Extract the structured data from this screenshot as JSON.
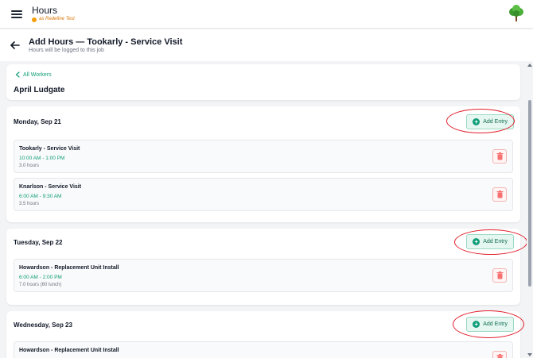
{
  "app": {
    "title": "Hours",
    "user_label": "as Redefine Test",
    "accent_color": "#0f9d78",
    "logo_icon": "tree-icon"
  },
  "header": {
    "title": "Add Hours — Tookarly - Service Visit",
    "subtitle": "Hours will be logged to this job"
  },
  "worker": {
    "back_label": "All Workers",
    "name": "April Ludgate"
  },
  "add_entry_label": "Add Entry",
  "days": [
    {
      "label": "Monday, Sep 21",
      "entries": [
        {
          "title": "Tookarly - Service Visit",
          "time": "10:00 AM - 1:00 PM",
          "duration": "3.0 hours"
        },
        {
          "title": "Knarlson - Service Visit",
          "time": "6:00 AM - 9:30 AM",
          "duration": "3.5 hours"
        }
      ]
    },
    {
      "label": "Tuesday, Sep 22",
      "entries": [
        {
          "title": "Howardson - Replacement Unit Install",
          "time": "6:00 AM - 2:00 PM",
          "duration": "7.0 hours (60 lunch)"
        }
      ]
    },
    {
      "label": "Wednesday, Sep 23",
      "entries": [
        {
          "title": "Howardson - Replacement Unit Install"
        }
      ]
    }
  ]
}
